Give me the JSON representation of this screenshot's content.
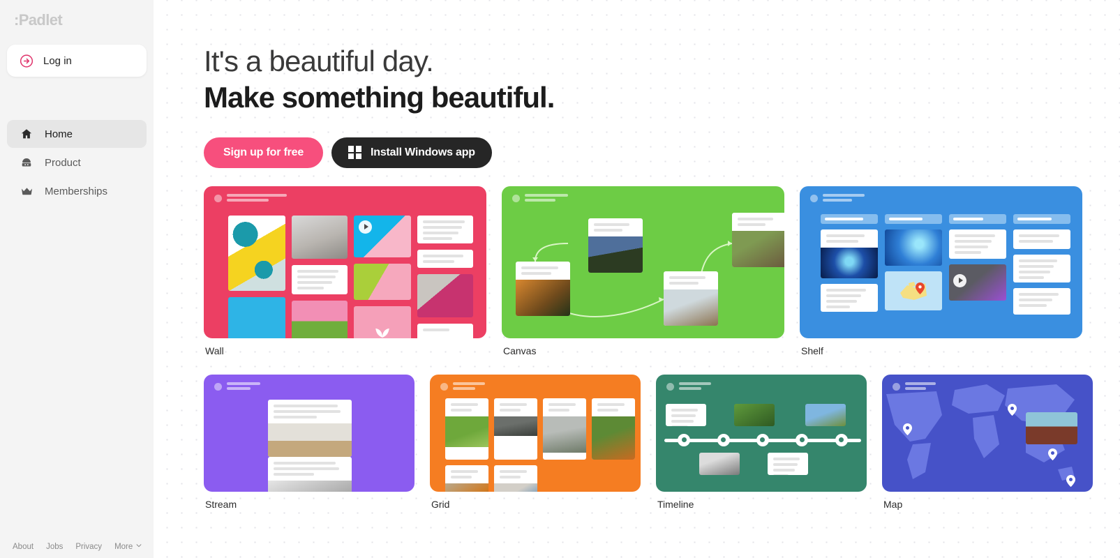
{
  "brand": {
    "logo_text": ":Padlet"
  },
  "sidebar": {
    "login": {
      "label": "Log in",
      "icon": "arrow-circle-right-icon"
    },
    "nav": [
      {
        "label": "Home",
        "icon": "home-icon",
        "active": true
      },
      {
        "label": "Product",
        "icon": "product-icon",
        "active": false
      },
      {
        "label": "Memberships",
        "icon": "crown-icon",
        "active": false
      }
    ],
    "footer_links": [
      {
        "label": "About"
      },
      {
        "label": "Jobs"
      },
      {
        "label": "Privacy"
      },
      {
        "label": "More",
        "icon": "chevron-down-icon"
      }
    ]
  },
  "hero": {
    "line1": "It's a beautiful day.",
    "line2": "Make something beautiful.",
    "signup_button": "Sign up for free",
    "install_button": "Install Windows app",
    "install_icon": "windows-logo-icon",
    "signup_color": "#f74f7d",
    "install_color": "#262626"
  },
  "templates": {
    "row1": [
      {
        "label": "Wall",
        "color": "#ec3f63"
      },
      {
        "label": "Canvas",
        "color": "#6dcc45"
      },
      {
        "label": "Shelf",
        "color": "#3a8fe0"
      }
    ],
    "row2": [
      {
        "label": "Stream",
        "color": "#8b5cf0"
      },
      {
        "label": "Grid",
        "color": "#f57d22"
      },
      {
        "label": "Timeline",
        "color": "#35866c"
      },
      {
        "label": "Map",
        "color": "#4652c8"
      }
    ]
  }
}
